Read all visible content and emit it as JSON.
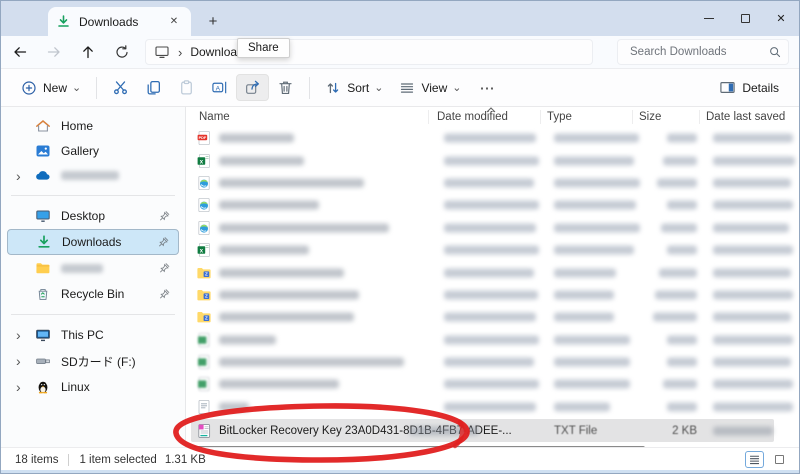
{
  "titlebar": {
    "tab_title": "Downloads"
  },
  "navbar": {
    "breadcrumb_folder": "Downloads",
    "tooltip_share": "Share",
    "search_placeholder": "Search Downloads"
  },
  "toolbar": {
    "new_label": "New",
    "sort_label": "Sort",
    "view_label": "View",
    "details_label": "Details"
  },
  "sidebar": {
    "quick": [
      {
        "label": "Home",
        "icon": "home-icon"
      },
      {
        "label": "Gallery",
        "icon": "gallery-icon"
      },
      {
        "label": "",
        "icon": "onedrive-cloud-icon",
        "chevron": true,
        "blur": 58
      }
    ],
    "pinned": [
      {
        "label": "Desktop",
        "icon": "desktop-monitor-icon",
        "pin": true
      },
      {
        "label": "Downloads",
        "icon": "download-arrow-icon",
        "pin": true,
        "selected": true
      },
      {
        "label": "",
        "icon": "folder-icon",
        "pin": true,
        "blur": 42
      },
      {
        "label": "Recycle Bin",
        "icon": "recycle-bin-icon",
        "pin": true
      }
    ],
    "drives": [
      {
        "label": "This PC",
        "icon": "this-pc-icon",
        "chevron": true
      },
      {
        "label": "SDカード (F:)",
        "icon": "usb-drive-icon",
        "chevron": true
      },
      {
        "label": "Linux",
        "icon": "linux-penguin-icon",
        "chevron": true
      }
    ]
  },
  "files": {
    "columns": [
      "Name",
      "Date modified",
      "Type",
      "Size",
      "Date last saved"
    ],
    "rows": [
      {
        "icon": "pdf-file-icon",
        "nw": 75,
        "dw": 92,
        "tw": 85,
        "sw": 30,
        "vw": 80
      },
      {
        "icon": "excel-file-icon",
        "nw": 85,
        "dw": 95,
        "tw": 80,
        "sw": 34,
        "vw": 82
      },
      {
        "icon": "edge-html-icon",
        "nw": 145,
        "dw": 90,
        "tw": 86,
        "sw": 40,
        "vw": 78
      },
      {
        "icon": "edge-html-icon",
        "nw": 100,
        "dw": 95,
        "tw": 82,
        "sw": 30,
        "vw": 80
      },
      {
        "icon": "edge-html-icon",
        "nw": 170,
        "dw": 92,
        "tw": 86,
        "sw": 36,
        "vw": 76
      },
      {
        "icon": "excel-file-icon",
        "nw": 90,
        "dw": 95,
        "tw": 80,
        "sw": 30,
        "vw": 80
      },
      {
        "icon": "zip-folder-icon",
        "nw": 125,
        "dw": 90,
        "tw": 62,
        "sw": 38,
        "vw": 78
      },
      {
        "icon": "zip-folder-icon",
        "nw": 140,
        "dw": 94,
        "tw": 60,
        "sw": 42,
        "vw": 80
      },
      {
        "icon": "zip-folder-icon",
        "nw": 135,
        "dw": 92,
        "tw": 60,
        "sw": 44,
        "vw": 78
      },
      {
        "icon": "green-doc-icon",
        "nw": 57,
        "dw": 95,
        "tw": 76,
        "sw": 30,
        "vw": 80
      },
      {
        "icon": "green-doc-icon",
        "nw": 185,
        "dw": 90,
        "tw": 76,
        "sw": 30,
        "vw": 78
      },
      {
        "icon": "green-doc-icon",
        "nw": 120,
        "dw": 95,
        "tw": 76,
        "sw": 34,
        "vw": 80
      },
      {
        "icon": "text-file-icon",
        "nw": 30,
        "dw": 92,
        "tw": 56,
        "sw": 30,
        "vw": 80
      }
    ],
    "selected": {
      "name": "BitLocker Recovery Key 23A0D431-8D1B-4FB7-ADEE-...",
      "type": "TXT File",
      "size": "2 KB",
      "icon": "notepad-file-icon"
    }
  },
  "statusbar": {
    "count": "18 items",
    "selected": "1 item selected",
    "size": "1.31 KB"
  },
  "icons": {
    "chevron_down": "⌄",
    "chevron_right": "›",
    "more": "⋯",
    "close": "✕",
    "plus": "+"
  },
  "colors": {
    "accent": "#0067c0",
    "annotation": "#e01f1f",
    "selection_blue": "#cde7f8",
    "titlebar": "#d3deee"
  }
}
